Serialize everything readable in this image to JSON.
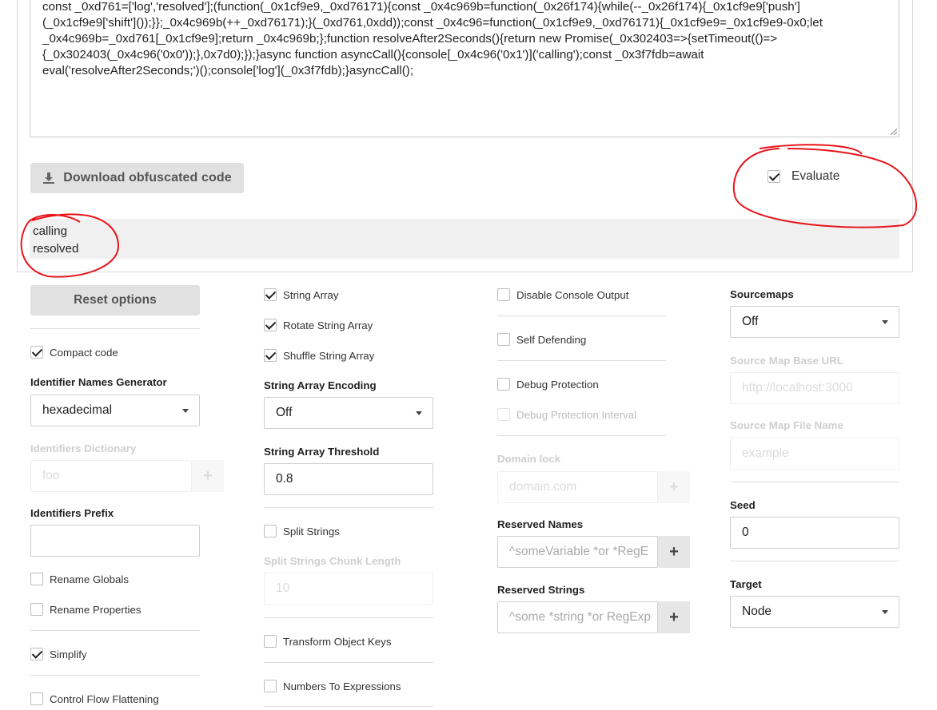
{
  "code": {
    "line1": "const _0xd761=['log','resolved'];(function(_0x1cf9e9,_0xd76171){const _0x4c969b=function(_0x26f174){while(--_0x26f174){_0x1cf9e9['push']",
    "line2": "(_0x1cf9e9['shift']());}};_0x4c969b(++_0xd76171);}(_0xd761,0xdd));const _0x4c96=function(_0x1cf9e9,_0xd76171){_0x1cf9e9=_0x1cf9e9-0x0;let",
    "line3": "_0x4c969b=_0xd761[_0x1cf9e9];return _0x4c969b;};function resolveAfter2Seconds(){return new Promise(_0x302403=>{setTimeout(()=>",
    "line4": "{_0x302403(_0x4c96('0x0'));},0x7d0);});}async function asyncCall(){console[_0x4c96('0x1')]('calling');const _0x3f7fdb=await",
    "line5": "eval('resolveAfter2Seconds;')();console['log'](_0x3f7fdb);}asyncCall();"
  },
  "toolbar": {
    "download_label": "Download obfuscated code",
    "evaluate_label": "Evaluate"
  },
  "output": {
    "lines": [
      "calling",
      "resolved"
    ]
  },
  "col1": {
    "reset_label": "Reset options",
    "compact_code": "Compact code",
    "identifier_generator_label": "Identifier Names Generator",
    "identifier_generator_value": "hexadecimal",
    "identifiers_dictionary_label": "Identifiers Dictionary",
    "identifiers_dictionary_placeholder": "foo",
    "identifiers_prefix_label": "Identifiers Prefix",
    "rename_globals": "Rename Globals",
    "rename_properties": "Rename Properties",
    "simplify": "Simplify",
    "control_flow": "Control Flow Flattening"
  },
  "col2": {
    "string_array": "String Array",
    "rotate_string_array": "Rotate String Array",
    "shuffle_string_array": "Shuffle String Array",
    "encoding_label": "String Array Encoding",
    "encoding_value": "Off",
    "threshold_label": "String Array Threshold",
    "threshold_value": "0.8",
    "split_strings": "Split Strings",
    "chunk_length_label": "Split Strings Chunk Length",
    "chunk_length_value": "10",
    "transform_object_keys": "Transform Object Keys",
    "numbers_to_expressions": "Numbers To Expressions"
  },
  "col3": {
    "disable_console": "Disable Console Output",
    "self_defending": "Self Defending",
    "debug_protection": "Debug Protection",
    "debug_protection_interval": "Debug Protection Interval",
    "domain_lock_label": "Domain lock",
    "domain_lock_placeholder": "domain.com",
    "reserved_names_label": "Reserved Names",
    "reserved_names_placeholder": "^someVariable *or *RegE",
    "reserved_strings_label": "Reserved Strings",
    "reserved_strings_placeholder": "^some *string *or RegExp"
  },
  "col4": {
    "sourcemaps_label": "Sourcemaps",
    "sourcemaps_value": "Off",
    "base_url_label": "Source Map Base URL",
    "base_url_placeholder": "http://localhost:3000",
    "file_name_label": "Source Map File Name",
    "file_name_placeholder": "example",
    "seed_label": "Seed",
    "seed_value": "0",
    "target_label": "Target",
    "target_value": "Node"
  },
  "colors": {
    "button_bg": "#e1e1e1",
    "annotation_red": "#e8141b"
  },
  "icons": [
    "download-icon",
    "checkbox-icon",
    "chevron-down-icon",
    "plus-icon",
    "resize-handle-icon"
  ]
}
